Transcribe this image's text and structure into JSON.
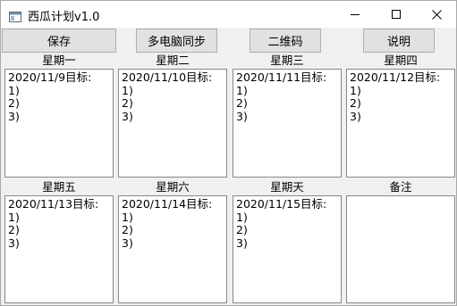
{
  "window": {
    "title": "西瓜计划v1.0"
  },
  "toolbar": {
    "save_label": "保存",
    "sync_label": "多电脑同步",
    "qrcode_label": "二维码",
    "help_label": "说明"
  },
  "days": [
    {
      "label": "星期一",
      "content": "2020/11/9目标:\n1)\n2)\n3)"
    },
    {
      "label": "星期二",
      "content": "2020/11/10目标:\n1)\n2)\n3)"
    },
    {
      "label": "星期三",
      "content": "2020/11/11目标:\n1)\n2)\n3)"
    },
    {
      "label": "星期四",
      "content": "2020/11/12目标:\n1)\n2)\n3)"
    },
    {
      "label": "星期五",
      "content": "2020/11/13目标:\n1)\n2)\n3)"
    },
    {
      "label": "星期六",
      "content": "2020/11/14目标:\n1)\n2)\n3)"
    },
    {
      "label": "星期天",
      "content": "2020/11/15目标:\n1)\n2)\n3)"
    }
  ],
  "notes": {
    "label": "备注",
    "content": ""
  },
  "icons": {
    "app": "app-window-icon",
    "minimize": "minimize-icon",
    "maximize": "maximize-icon",
    "close": "close-icon"
  }
}
